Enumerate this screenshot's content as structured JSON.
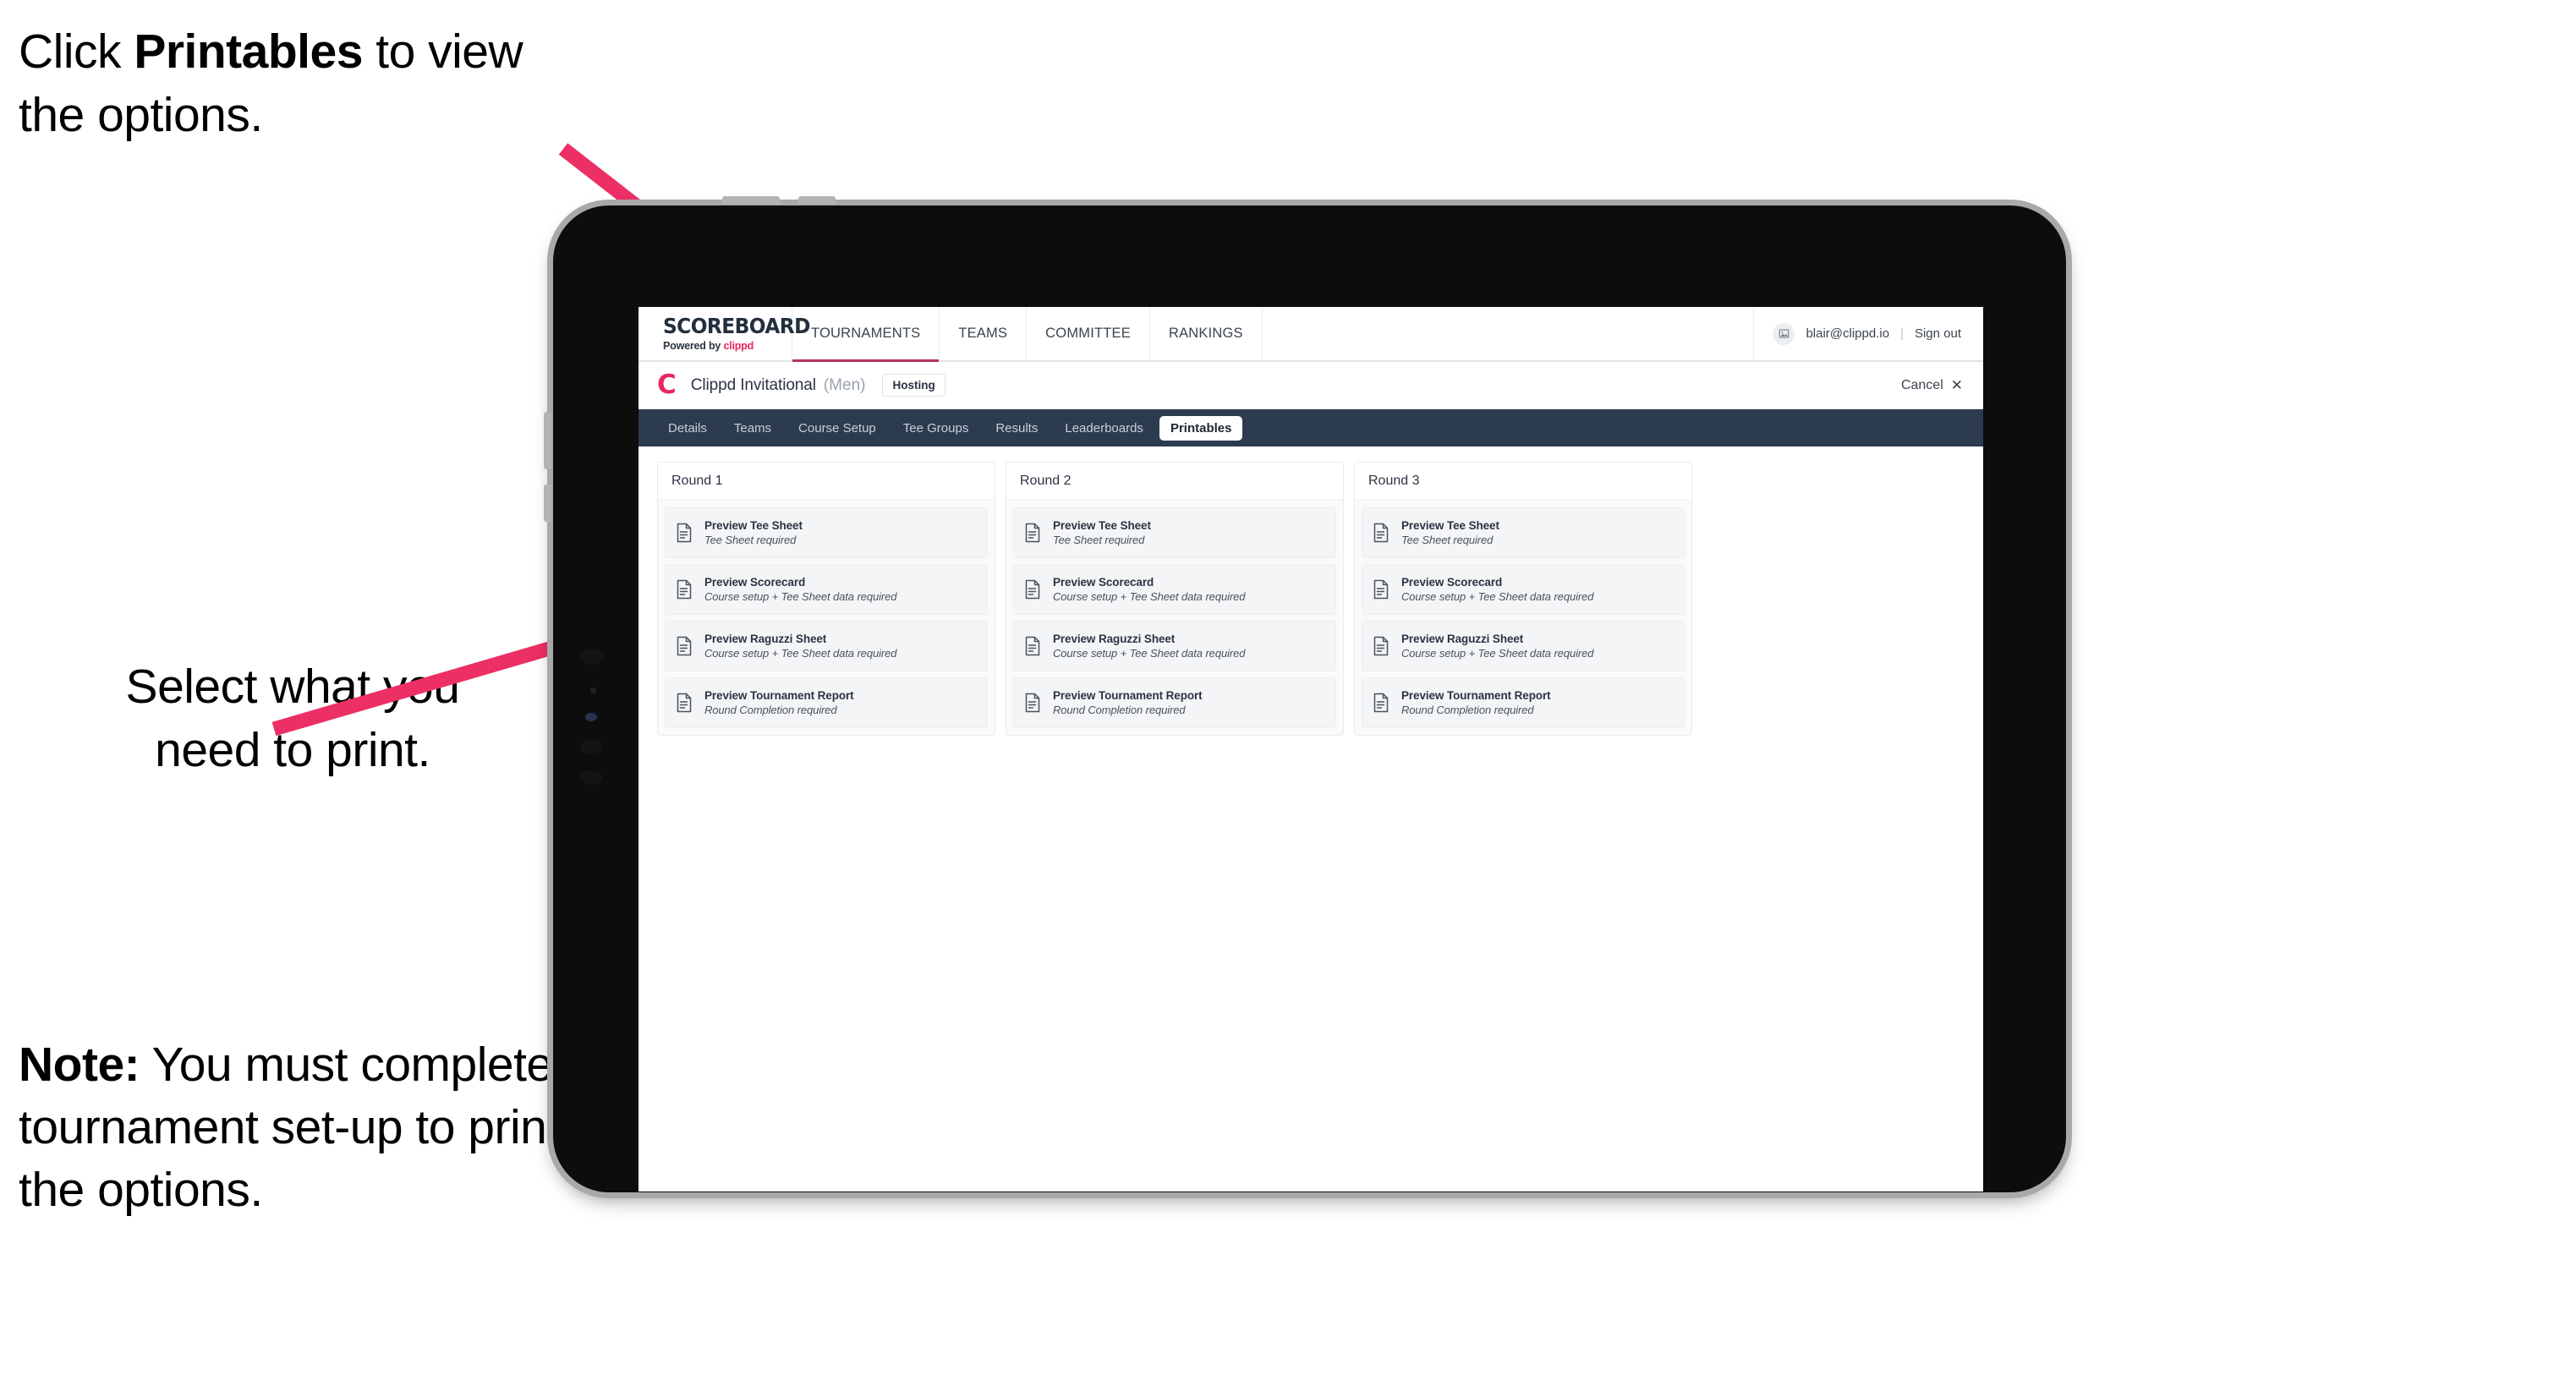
{
  "annotations": {
    "click_printables": {
      "pre": "Click ",
      "bold": "Printables",
      "post": " to view the options."
    },
    "select_print": "Select what you\nneed to print.",
    "note": {
      "bold": "Note:",
      "post": " You must complete the tournament set-up to print all the options."
    }
  },
  "colors": {
    "arrow_pink": "#ec2f64",
    "accent_pink": "#e8275b",
    "tabstrip_navy": "#2d3b50",
    "bezel_black": "#0d0d0d",
    "bezel_metal": "#a9a9a9"
  },
  "app": {
    "brand": {
      "title": "SCOREBOARD",
      "powered_by_prefix": "Powered by ",
      "powered_by_brand": "clippd"
    },
    "topnav": [
      {
        "label": "TOURNAMENTS",
        "active": true
      },
      {
        "label": "TEAMS",
        "active": false
      },
      {
        "label": "COMMITTEE",
        "active": false
      },
      {
        "label": "RANKINGS",
        "active": false
      }
    ],
    "account": {
      "avatar_icon": "user-image-icon",
      "email": "blair@clippd.io",
      "divider": "|",
      "sign_out": "Sign out"
    },
    "title_row": {
      "logo_mark": "C",
      "tournament_name": "Clippd Invitational",
      "gender": "(Men)",
      "role_chip": "Hosting",
      "cancel_label": "Cancel",
      "cancel_icon": "close-x-icon"
    },
    "tabs": [
      {
        "label": "Details",
        "active": false
      },
      {
        "label": "Teams",
        "active": false
      },
      {
        "label": "Course Setup",
        "active": false
      },
      {
        "label": "Tee Groups",
        "active": false
      },
      {
        "label": "Results",
        "active": false
      },
      {
        "label": "Leaderboards",
        "active": false
      },
      {
        "label": "Printables",
        "active": true
      }
    ],
    "rounds": [
      {
        "header": "Round 1",
        "items": [
          {
            "title": "Preview Tee Sheet",
            "sub": "Tee Sheet required",
            "icon": "document-icon"
          },
          {
            "title": "Preview Scorecard",
            "sub": "Course setup + Tee Sheet data required",
            "icon": "document-icon"
          },
          {
            "title": "Preview Raguzzi Sheet",
            "sub": "Course setup + Tee Sheet data required",
            "icon": "document-icon"
          },
          {
            "title": "Preview Tournament Report",
            "sub": "Round Completion required",
            "icon": "document-icon"
          }
        ]
      },
      {
        "header": "Round 2",
        "items": [
          {
            "title": "Preview Tee Sheet",
            "sub": "Tee Sheet required",
            "icon": "document-icon"
          },
          {
            "title": "Preview Scorecard",
            "sub": "Course setup + Tee Sheet data required",
            "icon": "document-icon"
          },
          {
            "title": "Preview Raguzzi Sheet",
            "sub": "Course setup + Tee Sheet data required",
            "icon": "document-icon"
          },
          {
            "title": "Preview Tournament Report",
            "sub": "Round Completion required",
            "icon": "document-icon"
          }
        ]
      },
      {
        "header": "Round 3",
        "items": [
          {
            "title": "Preview Tee Sheet",
            "sub": "Tee Sheet required",
            "icon": "document-icon"
          },
          {
            "title": "Preview Scorecard",
            "sub": "Course setup + Tee Sheet data required",
            "icon": "document-icon"
          },
          {
            "title": "Preview Raguzzi Sheet",
            "sub": "Course setup + Tee Sheet data required",
            "icon": "document-icon"
          },
          {
            "title": "Preview Tournament Report",
            "sub": "Round Completion required",
            "icon": "document-icon"
          }
        ]
      }
    ]
  }
}
